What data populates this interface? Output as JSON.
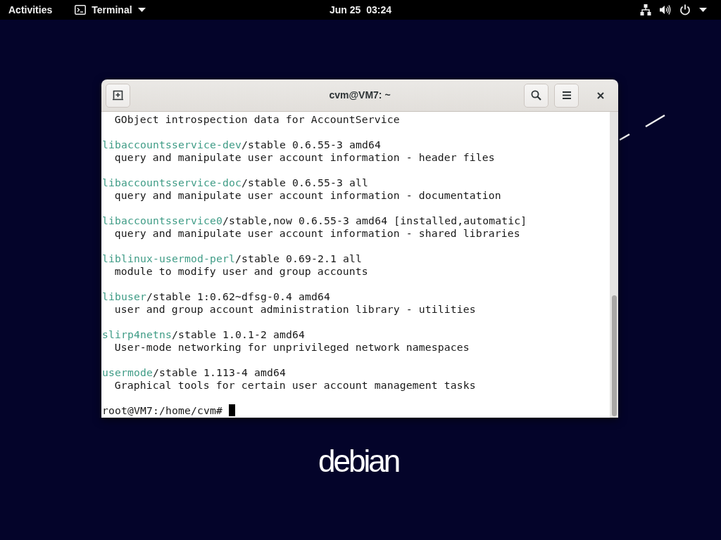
{
  "top_bar": {
    "activities": "Activities",
    "app_menu": "Terminal",
    "clock": "Jun 25  03:24"
  },
  "terminal": {
    "title": "cvm@VM7: ~",
    "output": [
      {
        "kind": "description",
        "text": "GObject introspection data for AccountService"
      },
      {
        "kind": "package",
        "name": "libaccountsservice-dev",
        "details": "/stable 0.6.55-3 amd64",
        "description": "query and manipulate user account information - header files"
      },
      {
        "kind": "package",
        "name": "libaccountsservice-doc",
        "details": "/stable 0.6.55-3 all",
        "description": "query and manipulate user account information - documentation"
      },
      {
        "kind": "package",
        "name": "libaccountsservice0",
        "details": "/stable,now 0.6.55-3 amd64 [installed,automatic]",
        "description": "query and manipulate user account information - shared libraries"
      },
      {
        "kind": "package",
        "name": "liblinux-usermod-perl",
        "details": "/stable 0.69-2.1 all",
        "description": "module to modify user and group accounts"
      },
      {
        "kind": "package",
        "name": "libuser",
        "details": "/stable 1:0.62~dfsg-0.4 amd64",
        "description": "user and group account administration library - utilities"
      },
      {
        "kind": "package",
        "name": "slirp4netns",
        "details": "/stable 1.0.1-2 amd64",
        "description": "User-mode networking for unprivileged network namespaces"
      },
      {
        "kind": "package",
        "name": "usermode",
        "details": "/stable 1.113-4 amd64",
        "description": "Graphical tools for certain user account management tasks"
      }
    ],
    "prompt": "root@VM7:/home/cvm#"
  },
  "desktop": {
    "logo": "debian"
  }
}
